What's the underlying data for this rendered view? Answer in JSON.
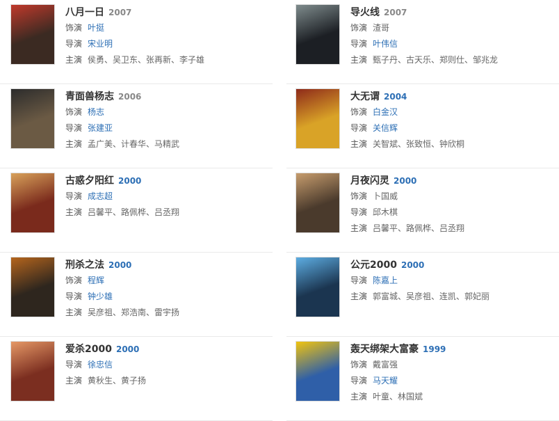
{
  "colors": {
    "link": "#2d6fb5",
    "title": "#333333",
    "muted": "#888888",
    "separator": "#e9e9e9"
  },
  "labels": {
    "actor": "饰演",
    "director": "导演",
    "starring": "主演"
  },
  "movies": [
    {
      "title": "八月一日",
      "year": "2007",
      "year_style": "grey",
      "lines": [
        {
          "label": "饰演",
          "value": "叶挺",
          "link": true
        },
        {
          "label": "导演",
          "value": "宋业明",
          "link": true
        },
        {
          "label": "主演",
          "value": "侯勇、吴卫东、张再新、李子雄",
          "link": false
        }
      ],
      "poster": {
        "bg": "#3b2a22",
        "accent": "#c0392b"
      }
    },
    {
      "title": "导火线",
      "year": "2007",
      "year_style": "grey",
      "lines": [
        {
          "label": "饰演",
          "value": "渣哥",
          "link": false
        },
        {
          "label": "导演",
          "value": "叶伟信",
          "link": true
        },
        {
          "label": "主演",
          "value": "甄子丹、古天乐、郑则仕、邹兆龙",
          "link": false
        }
      ],
      "poster": {
        "bg": "#1c1f24",
        "accent": "#7f8c8d"
      }
    },
    {
      "title": "青面兽杨志",
      "year": "2006",
      "year_style": "grey",
      "lines": [
        {
          "label": "饰演",
          "value": "杨志",
          "link": true
        },
        {
          "label": "导演",
          "value": "张建亚",
          "link": true
        },
        {
          "label": "主演",
          "value": "孟广美、计春华、马精武",
          "link": false
        }
      ],
      "poster": {
        "bg": "#6b5a44",
        "accent": "#2c2c2c"
      }
    },
    {
      "title": "大无谓",
      "year": "2004",
      "year_style": "blue",
      "lines": [
        {
          "label": "饰演",
          "value": "白金汉",
          "link": true
        },
        {
          "label": "导演",
          "value": "关信辉",
          "link": true
        },
        {
          "label": "主演",
          "value": "关智斌、张致恒、钟欣桐",
          "link": false
        }
      ],
      "poster": {
        "bg": "#d9a327",
        "accent": "#8e2a1a"
      }
    },
    {
      "title": "古惑夕阳红",
      "year": "2000",
      "year_style": "blue",
      "lines": [
        {
          "label": "导演",
          "value": "成志超",
          "link": true
        },
        {
          "label": "主演",
          "value": "吕馨平、路佩桦、吕丞翔",
          "link": false
        }
      ],
      "poster": {
        "bg": "#7a2a1c",
        "accent": "#d8a15a"
      }
    },
    {
      "title": "月夜闪灵",
      "year": "2000",
      "year_style": "blue",
      "lines": [
        {
          "label": "饰演",
          "value": "卜国威",
          "link": false
        },
        {
          "label": "导演",
          "value": "邱木棋",
          "link": false
        },
        {
          "label": "主演",
          "value": "吕馨平、路佩桦、吕丞翔",
          "link": false
        }
      ],
      "poster": {
        "bg": "#4a3a2c",
        "accent": "#c69c6d"
      }
    },
    {
      "title": "刑杀之法",
      "year": "2000",
      "year_style": "blue",
      "lines": [
        {
          "label": "饰演",
          "value": "程辉",
          "link": true
        },
        {
          "label": "导演",
          "value": "钟少雄",
          "link": true
        },
        {
          "label": "主演",
          "value": "吴彦祖、郑浩南、雷宇扬",
          "link": false
        }
      ],
      "poster": {
        "bg": "#2e261e",
        "accent": "#b5651d"
      }
    },
    {
      "title": "公元2000",
      "year": "2000",
      "year_style": "blue",
      "lines": [
        {
          "label": "导演",
          "value": "陈嘉上",
          "link": true
        },
        {
          "label": "主演",
          "value": "郭富城、吴彦祖、连凯、郭妃丽",
          "link": false
        }
      ],
      "poster": {
        "bg": "#1b3550",
        "accent": "#5dade2"
      }
    },
    {
      "title": "爱杀2000",
      "year": "2000",
      "year_style": "blue",
      "lines": [
        {
          "label": "导演",
          "value": "徐忠信",
          "link": true
        },
        {
          "label": "主演",
          "value": "黄秋生、黄子扬",
          "link": false
        }
      ],
      "poster": {
        "bg": "#7b2e20",
        "accent": "#e59866"
      }
    },
    {
      "title": "轰天绑架大富豪",
      "year": "1999",
      "year_style": "blue",
      "lines": [
        {
          "label": "饰演",
          "value": "戴富强",
          "link": false
        },
        {
          "label": "导演",
          "value": "马天耀",
          "link": true
        },
        {
          "label": "主演",
          "value": "叶童、林国斌",
          "link": false
        }
      ],
      "poster": {
        "bg": "#2f5fa8",
        "accent": "#f1c40f"
      }
    }
  ]
}
